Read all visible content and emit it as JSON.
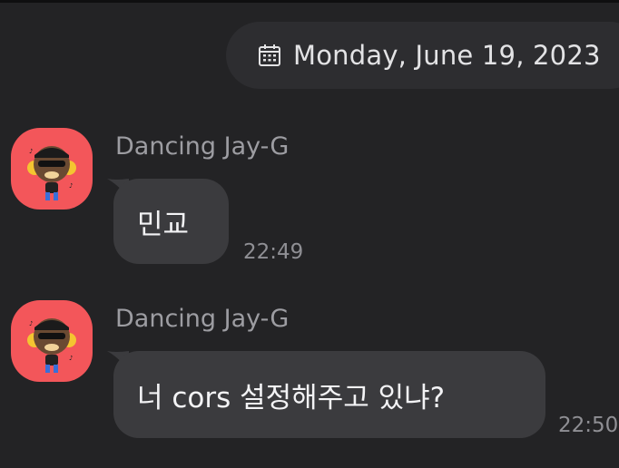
{
  "date_header": {
    "icon": "calendar-icon",
    "text": "Monday, June 19, 2023"
  },
  "messages": [
    {
      "sender": "Dancing Jay-G",
      "avatar": "dancing-jay-g-avatar",
      "text": "민교",
      "time": "22:49"
    },
    {
      "sender": "Dancing Jay-G",
      "avatar": "dancing-jay-g-avatar",
      "text": "너 cors 설정해주고 있냐?",
      "time": "22:50"
    }
  ],
  "colors": {
    "background": "#232325",
    "bubble": "#3b3b3e",
    "date_pill": "#2d2d30",
    "avatar_bg": "#f3565a",
    "sender_text": "#9d9da2",
    "time_text": "#8f8f94"
  }
}
